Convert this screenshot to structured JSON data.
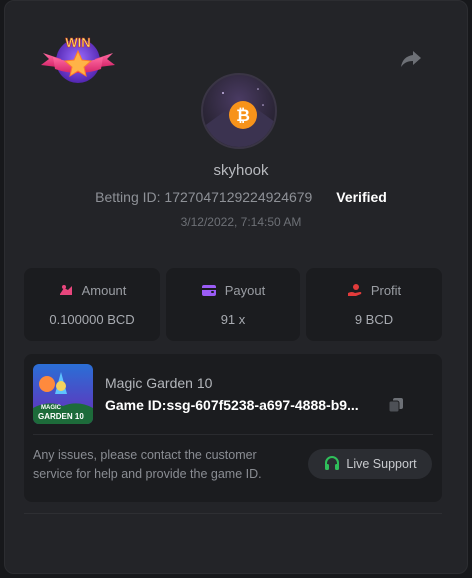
{
  "badge": {
    "text": "WIN"
  },
  "player": {
    "username": "skyhook",
    "betting_id": "Betting ID: 1727047129224924679",
    "verified": "Verified",
    "timestamp": "3/12/2022, 7:14:50 AM"
  },
  "stats": [
    {
      "label": "Amount",
      "value": "0.100000 BCD",
      "icon": "amount-icon",
      "color": "#e8467d"
    },
    {
      "label": "Payout",
      "value": "91 x",
      "icon": "wallet-icon",
      "color": "#9b5cf6"
    },
    {
      "label": "Profit",
      "value": "9 BCD",
      "icon": "profit-icon",
      "color": "#e23b3b"
    }
  ],
  "game": {
    "name": "Magic Garden 10",
    "game_id": "Game ID:ssg-607f5238-a697-4888-b9...",
    "thumb_text_1": "MAGIC",
    "thumb_text_2": "GARDEN 10"
  },
  "support": {
    "message": "Any issues, please contact the customer service for help and provide the game ID.",
    "button_label": "Live Support",
    "accent": "#2fbf5a"
  }
}
